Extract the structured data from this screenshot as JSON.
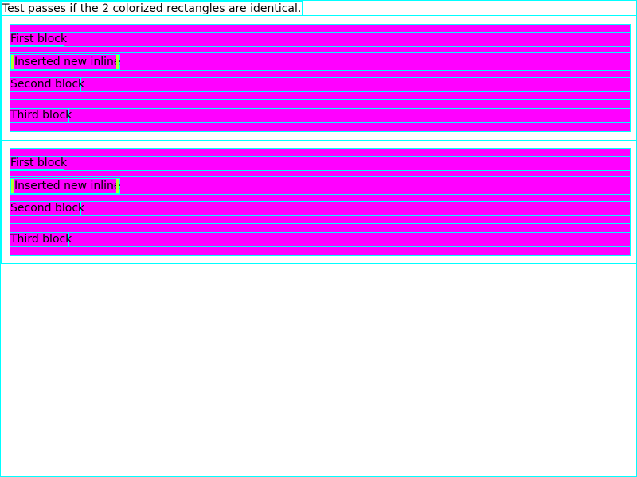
{
  "caption": "Test passes if the 2 colorized rectangles are identical.",
  "colors": {
    "block_background": "#ff00ff",
    "outline": "#00ffff",
    "inline_edge": "#adff2f"
  },
  "tests": [
    {
      "first_block": "First block",
      "inserted_inline": "Inserted new inline",
      "second_block": "Second block",
      "third_block": "Third block"
    },
    {
      "first_block": "First block",
      "inserted_inline": "Inserted new inline",
      "second_block": "Second block",
      "third_block": "Third block"
    }
  ]
}
